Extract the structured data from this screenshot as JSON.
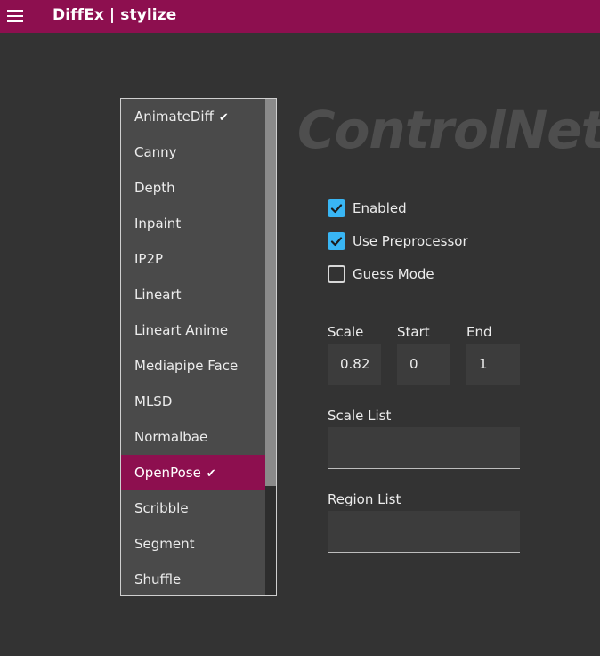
{
  "appbar": {
    "title": "DiffEx | stylize",
    "menu_icon": "hamburger-menu-icon"
  },
  "model_list": {
    "items": [
      {
        "label": "AnimateDiff",
        "checked": true
      },
      {
        "label": "Canny",
        "checked": false
      },
      {
        "label": "Depth",
        "checked": false
      },
      {
        "label": "Inpaint",
        "checked": false
      },
      {
        "label": "IP2P",
        "checked": false
      },
      {
        "label": "Lineart",
        "checked": false
      },
      {
        "label": "Lineart Anime",
        "checked": false
      },
      {
        "label": "Mediapipe Face",
        "checked": false
      },
      {
        "label": "MLSD",
        "checked": false
      },
      {
        "label": "Normalbae",
        "checked": false
      },
      {
        "label": "OpenPose",
        "checked": true,
        "selected": true
      },
      {
        "label": "Scribble",
        "checked": false
      },
      {
        "label": "Segment",
        "checked": false
      },
      {
        "label": "Shuffle",
        "checked": false
      }
    ],
    "check_glyph": "✔"
  },
  "watermark": "ControlNet",
  "options": {
    "enabled": {
      "label": "Enabled",
      "checked": true
    },
    "use_preprocessor": {
      "label": "Use Preprocessor",
      "checked": true
    },
    "guess_mode": {
      "label": "Guess Mode",
      "checked": false
    }
  },
  "fields": {
    "scale": {
      "label": "Scale",
      "value": "0.82"
    },
    "start": {
      "label": "Start",
      "value": "0"
    },
    "end": {
      "label": "End",
      "value": "1"
    },
    "scale_list": {
      "label": "Scale List",
      "value": ""
    },
    "region_list": {
      "label": "Region List",
      "value": ""
    }
  },
  "colors": {
    "accent": "#8d0f4f",
    "checkbox_on": "#39b6f4",
    "background": "#333333"
  }
}
